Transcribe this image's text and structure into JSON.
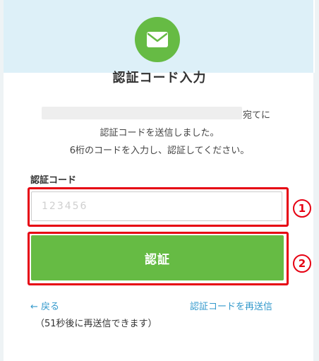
{
  "header": {
    "icon": "envelope-icon",
    "title": "認証コード入力"
  },
  "message": {
    "line1_suffix": "宛てに",
    "line2": "認証コードを送信しました。",
    "line3": "6桁のコードを入力し、認証してください。"
  },
  "form": {
    "label": "認証コード",
    "code_value": "",
    "code_placeholder": "123456",
    "submit_label": "認証"
  },
  "markers": {
    "first": "1",
    "second": "2"
  },
  "footer": {
    "back_label": "← 戻る",
    "resend_label": "認証コードを再送信",
    "countdown": "（51秒後に再送信できます）"
  },
  "colors": {
    "brand_green": "#66bb44",
    "link_blue": "#3399cc",
    "highlight_red": "#e60012",
    "header_band": "#ddf0f8"
  }
}
